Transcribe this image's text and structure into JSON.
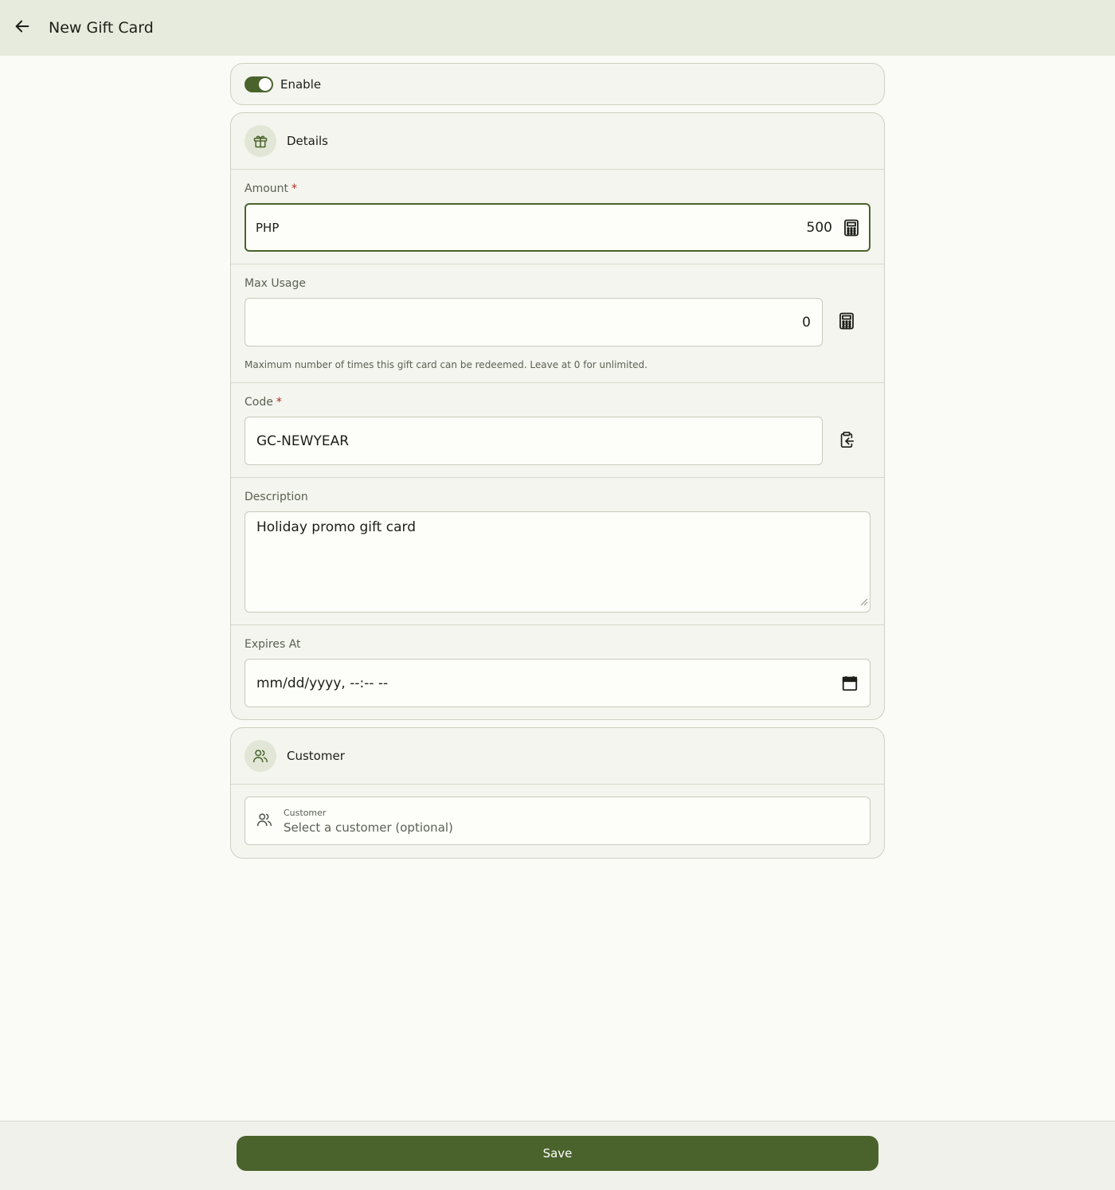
{
  "header": {
    "title": "New Gift Card",
    "back_icon": "arrow-left-icon"
  },
  "enable": {
    "label": "Enable",
    "checked": true
  },
  "details": {
    "title": "Details",
    "icon": "gift-icon",
    "amount": {
      "label": "Amount",
      "required_mark": "*",
      "currency": "PHP",
      "value": "500",
      "icon": "calculator-icon"
    },
    "max_usage": {
      "label": "Max Usage",
      "value": "0",
      "icon": "calculator-icon",
      "helper": "Maximum number of times this gift card can be redeemed. Leave at 0 for unlimited."
    },
    "code": {
      "label": "Code",
      "required_mark": "*",
      "value": "GC-NEWYEAR",
      "icon": "clipboard-icon"
    },
    "description": {
      "label": "Description",
      "value": "Holiday promo gift card"
    },
    "expires_at": {
      "label": "Expires At",
      "value": "mm/dd/yyyy, --:-- --",
      "icon": "calendar-icon"
    }
  },
  "customer": {
    "title": "Customer",
    "icon": "users-icon",
    "select": {
      "label": "Customer",
      "placeholder": "Select a customer (optional)"
    }
  },
  "footer": {
    "save_label": "Save"
  },
  "colors": {
    "accent": "#4a632c",
    "header_bg": "#e6ebde",
    "page_bg": "#fafbf6",
    "required": "#b3261e"
  }
}
